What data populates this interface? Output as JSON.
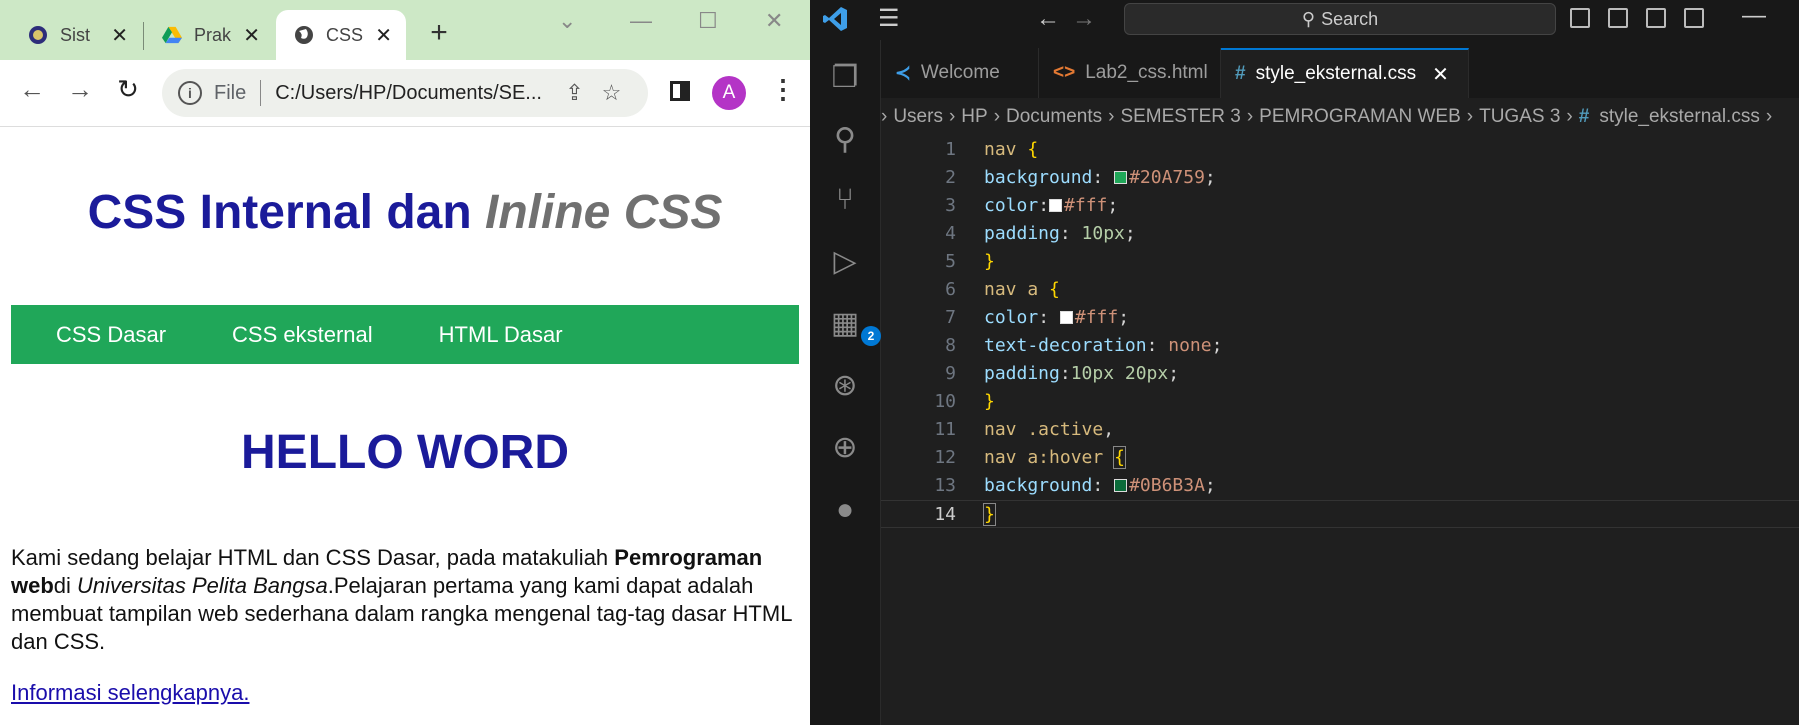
{
  "browser": {
    "tabs": [
      {
        "label": "Sist",
        "icon": "university-favicon-icon"
      },
      {
        "label": "Prak",
        "icon": "google-drive-favicon-icon"
      },
      {
        "label": "CSS",
        "icon": "globe-favicon-icon"
      }
    ],
    "omnibox": {
      "scheme_label": "File",
      "url": "C:/Users/HP/Documents/SE..."
    },
    "avatar_letter": "A"
  },
  "page": {
    "heading_part1": "CSS Internal dan ",
    "heading_part2": "Inline CSS",
    "nav": [
      "CSS Dasar",
      "CSS eksternal",
      "HTML Dasar"
    ],
    "hello": "HELLO WORD",
    "para": {
      "p1": "Kami sedang belajar HTML dan CSS Dasar, pada matakuliah ",
      "bold": "Pemrograman web",
      "p2": "di ",
      "italic": "Universitas Pelita Bangsa",
      "p3": ".Pelajaran pertama yang kami dapat adalah membuat tampilan web sederhana dalam rangka mengenal tag-tag dasar HTML dan CSS."
    },
    "link": "Informasi selengkapnya.",
    "nav_color": "#20A759",
    "heading_color": "#1b1b9a"
  },
  "vscode": {
    "search_label": "Search",
    "extensions_badge": "2",
    "tabs": [
      {
        "label": "Welcome"
      },
      {
        "label": "Lab2_css.html"
      },
      {
        "label": "style_eksternal.css"
      }
    ],
    "breadcrumb": [
      "Users",
      "HP",
      "Documents",
      "SEMESTER 3",
      "PEMROGRAMAN WEB",
      "TUGAS 3",
      "style_eksternal.css"
    ],
    "line_numbers": [
      "1",
      "2",
      "3",
      "4",
      "5",
      "6",
      "7",
      "8",
      "9",
      "10",
      "11",
      "12",
      "13",
      "14"
    ],
    "code": {
      "l1_sel": "nav",
      "l2_prop": "background",
      "l2_val": "#20A759",
      "l3_prop": "color",
      "l3_val": "#fff",
      "l4_prop": "padding",
      "l4_val": "10px",
      "l6_sel": "nav a",
      "l7_prop": "color",
      "l7_val": "#fff",
      "l8_prop": "text-decoration",
      "l8_val": "none",
      "l9_prop": "padding",
      "l9_val": "10px 20px",
      "l11_sel": "nav .active",
      "l12_sel": "nav a:hover",
      "l13_prop": "background",
      "l13_val": "#0B6B3A"
    }
  }
}
